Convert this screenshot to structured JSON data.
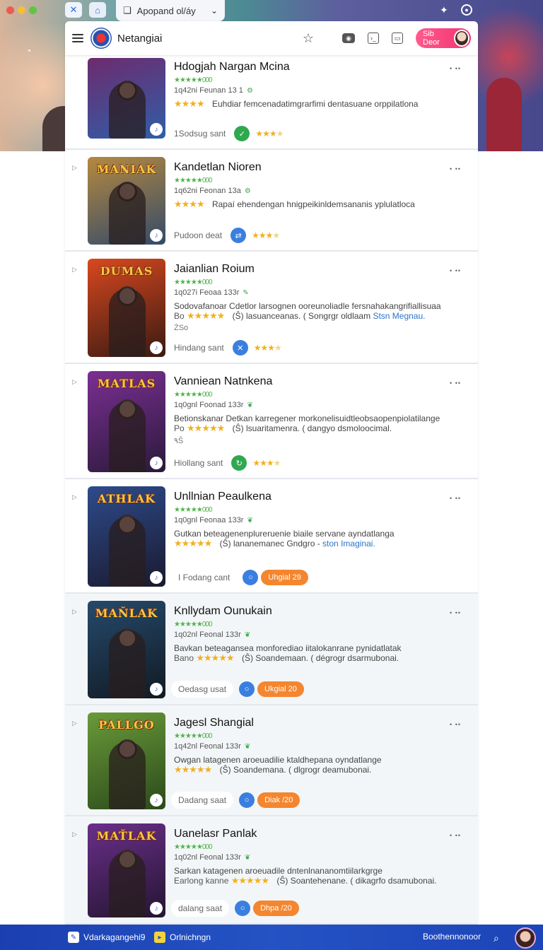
{
  "browser": {
    "url_text": "Apopand ol/áy",
    "back_icon": "window-icon",
    "tab_icons": [
      "x-icon",
      "bookmark-icon"
    ]
  },
  "toolbar": {
    "title": "Netangiai",
    "user_label": "Sib Deor"
  },
  "cards": [
    {
      "title": "Hdogjah Nargan Mcina",
      "stars_line": "★★★★★000",
      "meta": "1q42ni Feunan 13 1",
      "meta_icon": "gear-icon",
      "desc": "Euhdiar femcenadatimgrarfimi dentasuane orppilatlona",
      "desc_prefix": "",
      "desc2": "",
      "desc2_link": "",
      "extra": "",
      "status": "1Sodsug sant",
      "action": "check",
      "action_color": "green",
      "badge": "",
      "stars_rating": 4,
      "thumb_word": "",
      "thumb_colors": [
        "#6d2b6e",
        "#2f5ea8"
      ],
      "tint": false
    },
    {
      "title": "Kandetlan Nioren",
      "stars_line": "★★★★★000",
      "meta": "1q62ni Feonan 13a",
      "meta_icon": "gear-icon",
      "desc": "Rapaí ehendengan hnigpeikinldemsananis yplulatloca",
      "desc_prefix": "",
      "desc2": "",
      "desc2_link": "",
      "extra": "",
      "status": "Pudoon deat",
      "action": "share",
      "action_color": "blue",
      "badge": "",
      "stars_rating": 4,
      "thumb_word": "MANIAK",
      "thumb_colors": [
        "#b5893f",
        "#334a6a"
      ],
      "tint": false
    },
    {
      "title": "Jaianlian Roium",
      "stars_line": "★★★★★000",
      "meta": "1q027i Feoaa 133r",
      "meta_icon": "wand-icon",
      "desc": "Sodovafanoar Cdetlor larsognen ooreunoliadle fersnahakangrifiallisuaa",
      "desc_prefix": "Bo",
      "desc2": "(Ŝ) lasuanceanas. ( Songrgr oldlaam",
      "desc2_link": "Stsn Megnau.",
      "extra": "ŻSo",
      "status": "Hindang sant",
      "action": "close",
      "action_color": "blue",
      "badge": "",
      "stars_rating": 5,
      "thumb_word": "DUMAS",
      "thumb_colors": [
        "#d8481f",
        "#3a1a12"
      ],
      "tint": false
    },
    {
      "title": "Vanniean Natnkena",
      "stars_line": "★★★★★000",
      "meta": "1q0gnl Foonad 133r",
      "meta_icon": "leaf-icon",
      "desc": "Betionskanar Detkan karregener morkonelisuidtleobsaopenpiolatilange",
      "desc_prefix": "Po",
      "desc2": "(Ŝ) lsuaritamenra. ( dangyo dsmoloocimal.",
      "desc2_link": "",
      "extra": "٩Ŝ",
      "status": "Hiollang sant",
      "action": "refresh",
      "action_color": "green",
      "badge": "",
      "stars_rating": 5,
      "thumb_word": "MATLAS",
      "thumb_colors": [
        "#7b2f93",
        "#2a1a3a"
      ],
      "tint": false
    },
    {
      "title": "Unllnian Peaulkena",
      "stars_line": "★★★★★000",
      "meta": "1q0gnl Feonaa 133r",
      "meta_icon": "leaf-icon",
      "desc": "Gutkan beteagenenplureruenie biaile servane ayndatlanga",
      "desc_prefix": "",
      "desc2": "(Ŝ) lananemanec Gndgro -",
      "desc2_link": "ston Imaginai.",
      "extra": "",
      "status": "I Fodang cant",
      "action": "circle",
      "action_color": "blue",
      "badge": "Uhgial 29",
      "stars_rating": 5,
      "thumb_word": "ATHLAK",
      "thumb_colors": [
        "#2e4b8c",
        "#1a1a2e"
      ],
      "tint": false
    },
    {
      "title": "Knllydam Ounukain",
      "stars_line": "★★★★★000",
      "meta": "1q02nl Feonal 133r",
      "meta_icon": "leaf-icon",
      "desc": "Bavkan beteagansea monforediao iitalokanrane pynidatlatak",
      "desc_prefix": "Bano",
      "desc2": "(Ŝ) Soandemaan. ( dégrogr dsarmubonai.",
      "desc2_link": "",
      "extra": "",
      "status": "Oedasg usat",
      "action": "circle",
      "action_color": "blue",
      "badge": "Ukgial 20",
      "stars_rating": 5,
      "thumb_word": "MAŇLAK",
      "thumb_colors": [
        "#264a6b",
        "#111a24"
      ],
      "tint": true
    },
    {
      "title": "Jagesl Shangial",
      "stars_line": "★★★★★000",
      "meta": "1q42nl Feonal 133r",
      "meta_icon": "leaf-icon",
      "desc": "Owgan latagenen aroeuadilie ktaldhepana oyndatlange",
      "desc_prefix": "",
      "desc2": "(Ŝ) Soandemana. ( dlgrogr deamubonai.",
      "desc2_link": "",
      "extra": "",
      "status": "Dadang saat",
      "action": "circle",
      "action_color": "blue",
      "badge": "Diak /20",
      "stars_rating": 5,
      "thumb_word": "PALLGO",
      "thumb_colors": [
        "#6a9a3a",
        "#2b4a1a"
      ],
      "tint": true
    },
    {
      "title": "Uanelasr Panlak",
      "stars_line": "★★★★★000",
      "meta": "1q02nl Feonal 133r",
      "meta_icon": "leaf-icon",
      "desc": "Sarkan katagenen aroeuadile dntenlnananomtiilarkgrge",
      "desc_prefix": "Earlong kanne",
      "desc2": "(Ŝ) Soantehenane. ( dikagrfo dsamubonai.",
      "desc2_link": "",
      "extra": "",
      "status": "dalang saat",
      "action": "circle",
      "action_color": "blue",
      "badge": "Dhpa /20",
      "stars_rating": 5,
      "thumb_word": "MAŤLAK",
      "thumb_colors": [
        "#6a2f8a",
        "#241531"
      ],
      "tint": true
    }
  ],
  "bottombar": {
    "left_label": "Vdarkagangehi9",
    "mid_label": "Orlnichngn",
    "right_label": "Boothennonoor"
  },
  "colors": {
    "accent_pink": "#f0336f",
    "accent_orange": "#f4862f",
    "bar_blue": "#2453c4"
  }
}
